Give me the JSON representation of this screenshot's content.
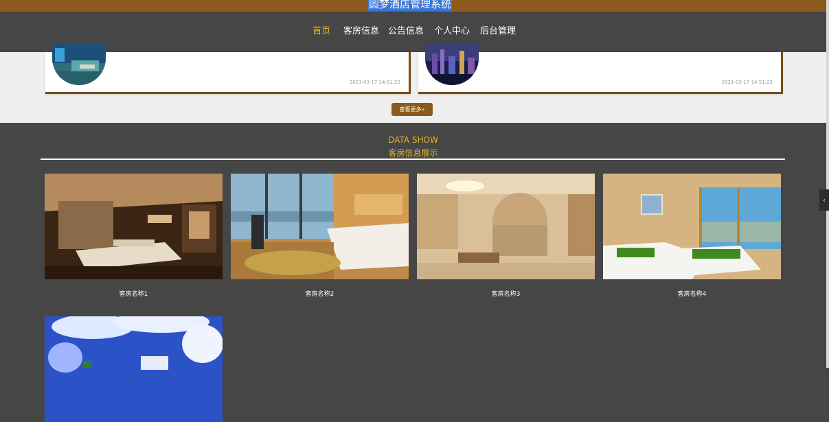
{
  "app": {
    "title": "圆梦酒店管理系统"
  },
  "nav": {
    "items": [
      "首页",
      "客房信息",
      "公告信息",
      "个人中心",
      "后台管理"
    ]
  },
  "notices": {
    "items": [
      {
        "date": "2021-03-17 14:51:23"
      },
      {
        "date": "2021-03-17 14:51:23"
      }
    ],
    "more_label": "查看更多»"
  },
  "data_show": {
    "title_en": "DATA SHOW",
    "title_cn": "客房信息展示"
  },
  "rooms": {
    "items": [
      {
        "name": "客房名称1"
      },
      {
        "name": "客房名称2"
      },
      {
        "name": "客房名称3"
      },
      {
        "name": "客房名称4"
      },
      {
        "name": ""
      }
    ]
  },
  "colors": {
    "brand": "#8b5a1c",
    "accent": "#e8b62c",
    "nav_bg": "#464646",
    "selection": "#3a76d6"
  },
  "icons": {
    "side_tab": "chevron-left-icon"
  }
}
